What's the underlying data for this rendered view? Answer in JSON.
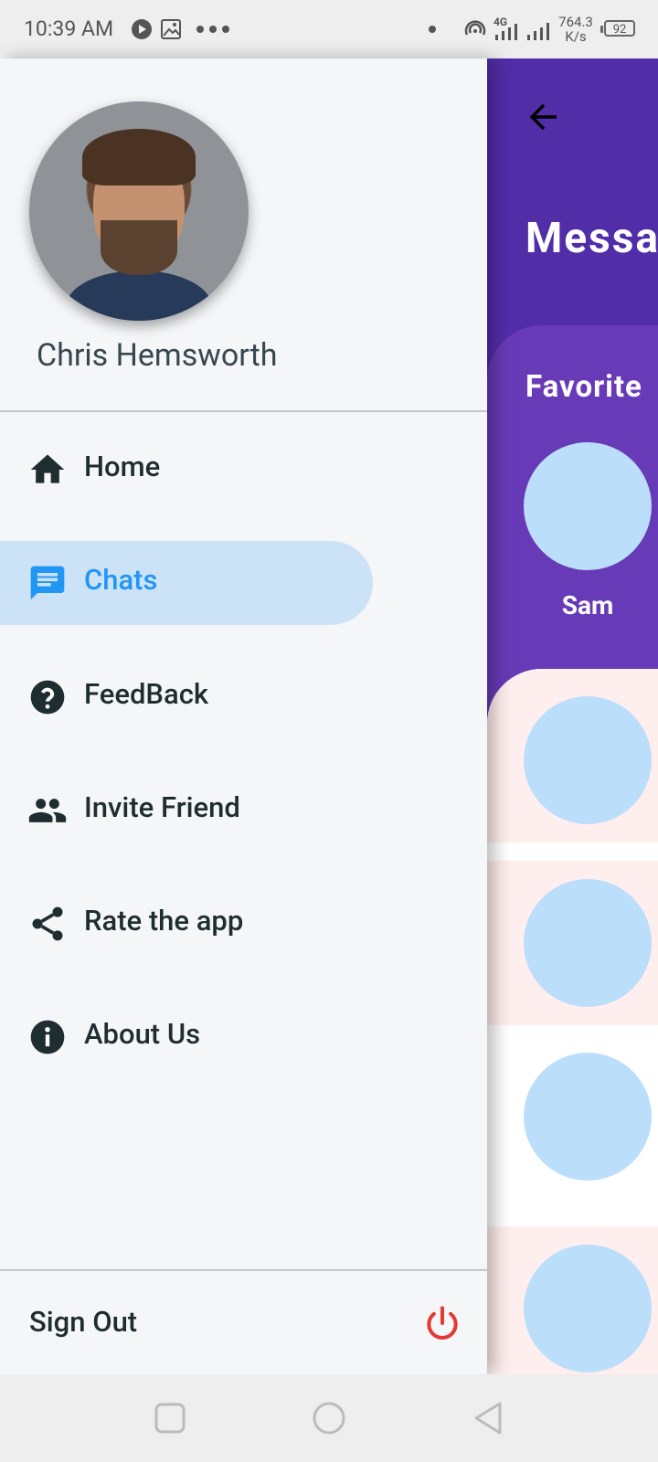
{
  "status_bar": {
    "time": "10:39 AM",
    "speed_value": "764.3",
    "speed_unit": "K/s",
    "battery": "92",
    "network_label": "4G",
    "icons": [
      "play-circle-icon",
      "image-icon",
      "more-dots-icon",
      "dot-icon",
      "hotspot-icon",
      "signal-icon",
      "signal-icon",
      "battery-icon"
    ]
  },
  "drawer": {
    "profile": {
      "name": "Chris Hemsworth"
    },
    "menu": [
      {
        "label": "Home",
        "icon": "home-icon",
        "active": false
      },
      {
        "label": "Chats",
        "icon": "chat-icon",
        "active": true
      },
      {
        "label": "FeedBack",
        "icon": "help-icon",
        "active": false
      },
      {
        "label": "Invite Friend",
        "icon": "people-icon",
        "active": false
      },
      {
        "label": "Rate the app",
        "icon": "share-icon",
        "active": false
      },
      {
        "label": "About Us",
        "icon": "info-icon",
        "active": false
      }
    ],
    "sign_out": {
      "label": "Sign Out",
      "icon": "power-icon"
    }
  },
  "app": {
    "title": "Messa",
    "favorites_title": "Favorite",
    "favorite_contacts": [
      {
        "name": "Sam"
      }
    ]
  },
  "nav_bar": {
    "buttons": [
      "recents-icon",
      "home-circle-icon",
      "back-triangle-icon"
    ]
  },
  "colors": {
    "accent": "#2196f3",
    "active_pill": "#cce2f7",
    "app_primary": "#512da8",
    "app_secondary": "#673ab7",
    "avatar_placeholder": "#bbdefb",
    "unread_row": "#ffeeee",
    "power_icon": "#e53935",
    "icon_dark": "#1e2d2f"
  }
}
